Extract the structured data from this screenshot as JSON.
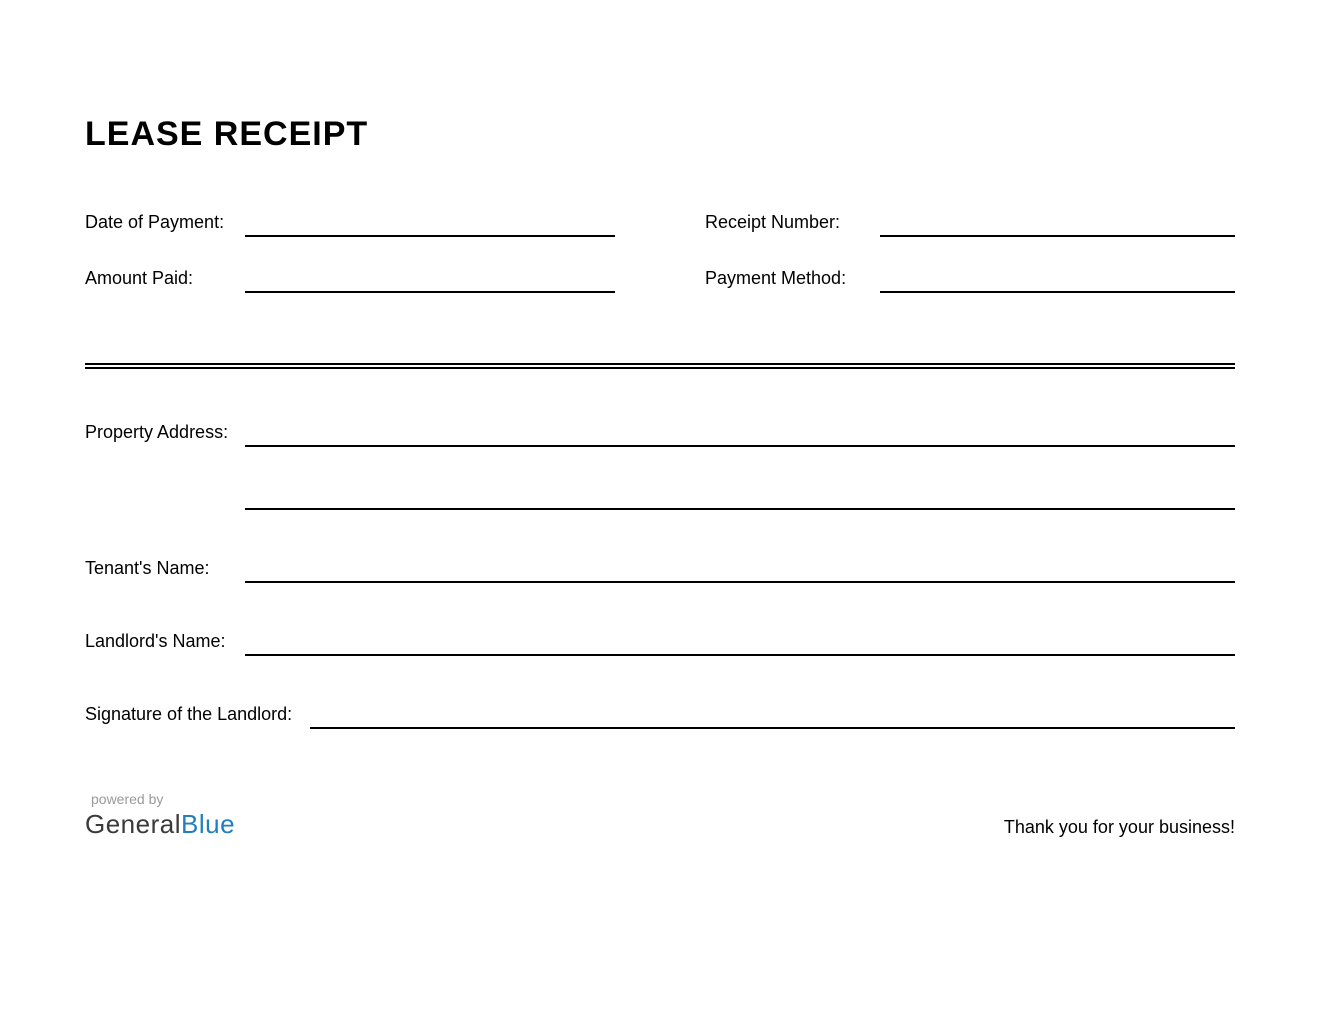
{
  "title": "LEASE RECEIPT",
  "fields": {
    "date_of_payment": "Date of Payment:",
    "receipt_number": "Receipt Number:",
    "amount_paid": "Amount Paid:",
    "payment_method": "Payment Method:",
    "property_address": "Property Address:",
    "tenant_name": "Tenant's Name:",
    "landlord_name": "Landlord's Name:",
    "signature": "Signature of the Landlord:"
  },
  "footer": {
    "powered_by": "powered by",
    "brand_first": "General",
    "brand_second": "Blue",
    "thanks": "Thank you for your business!"
  }
}
